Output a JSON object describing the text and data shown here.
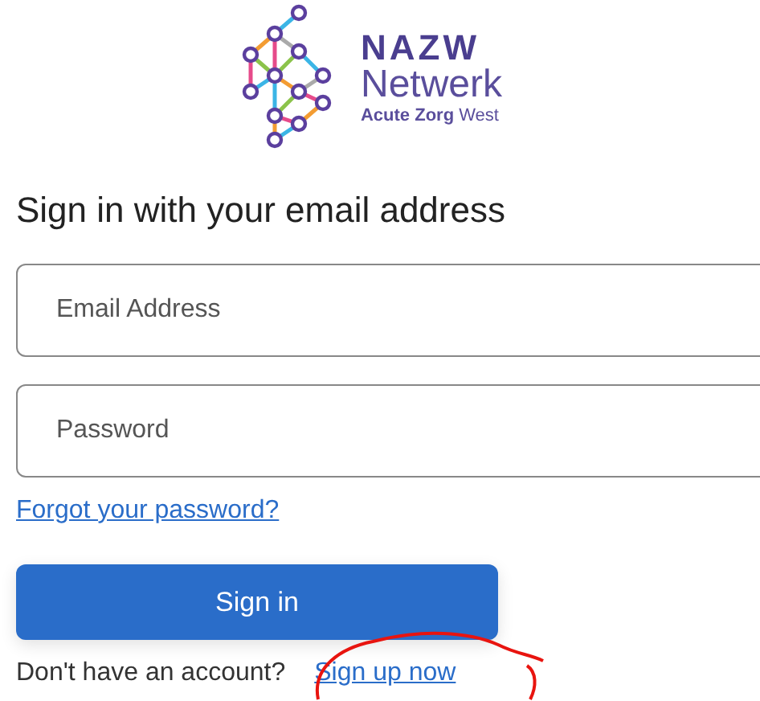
{
  "logo": {
    "title": "NAZW",
    "subtitle": "Netwerk",
    "tagline_bold": "Acute Zorg",
    "tagline_rest": "West"
  },
  "heading": "Sign in with your email address",
  "fields": [
    {
      "placeholder": "Email Address"
    },
    {
      "placeholder": "Password"
    }
  ],
  "forgot_link": "Forgot your password?",
  "sign_in_button": "Sign in",
  "signup_prompt": "Don't have an account?",
  "signup_link": "Sign up now"
}
